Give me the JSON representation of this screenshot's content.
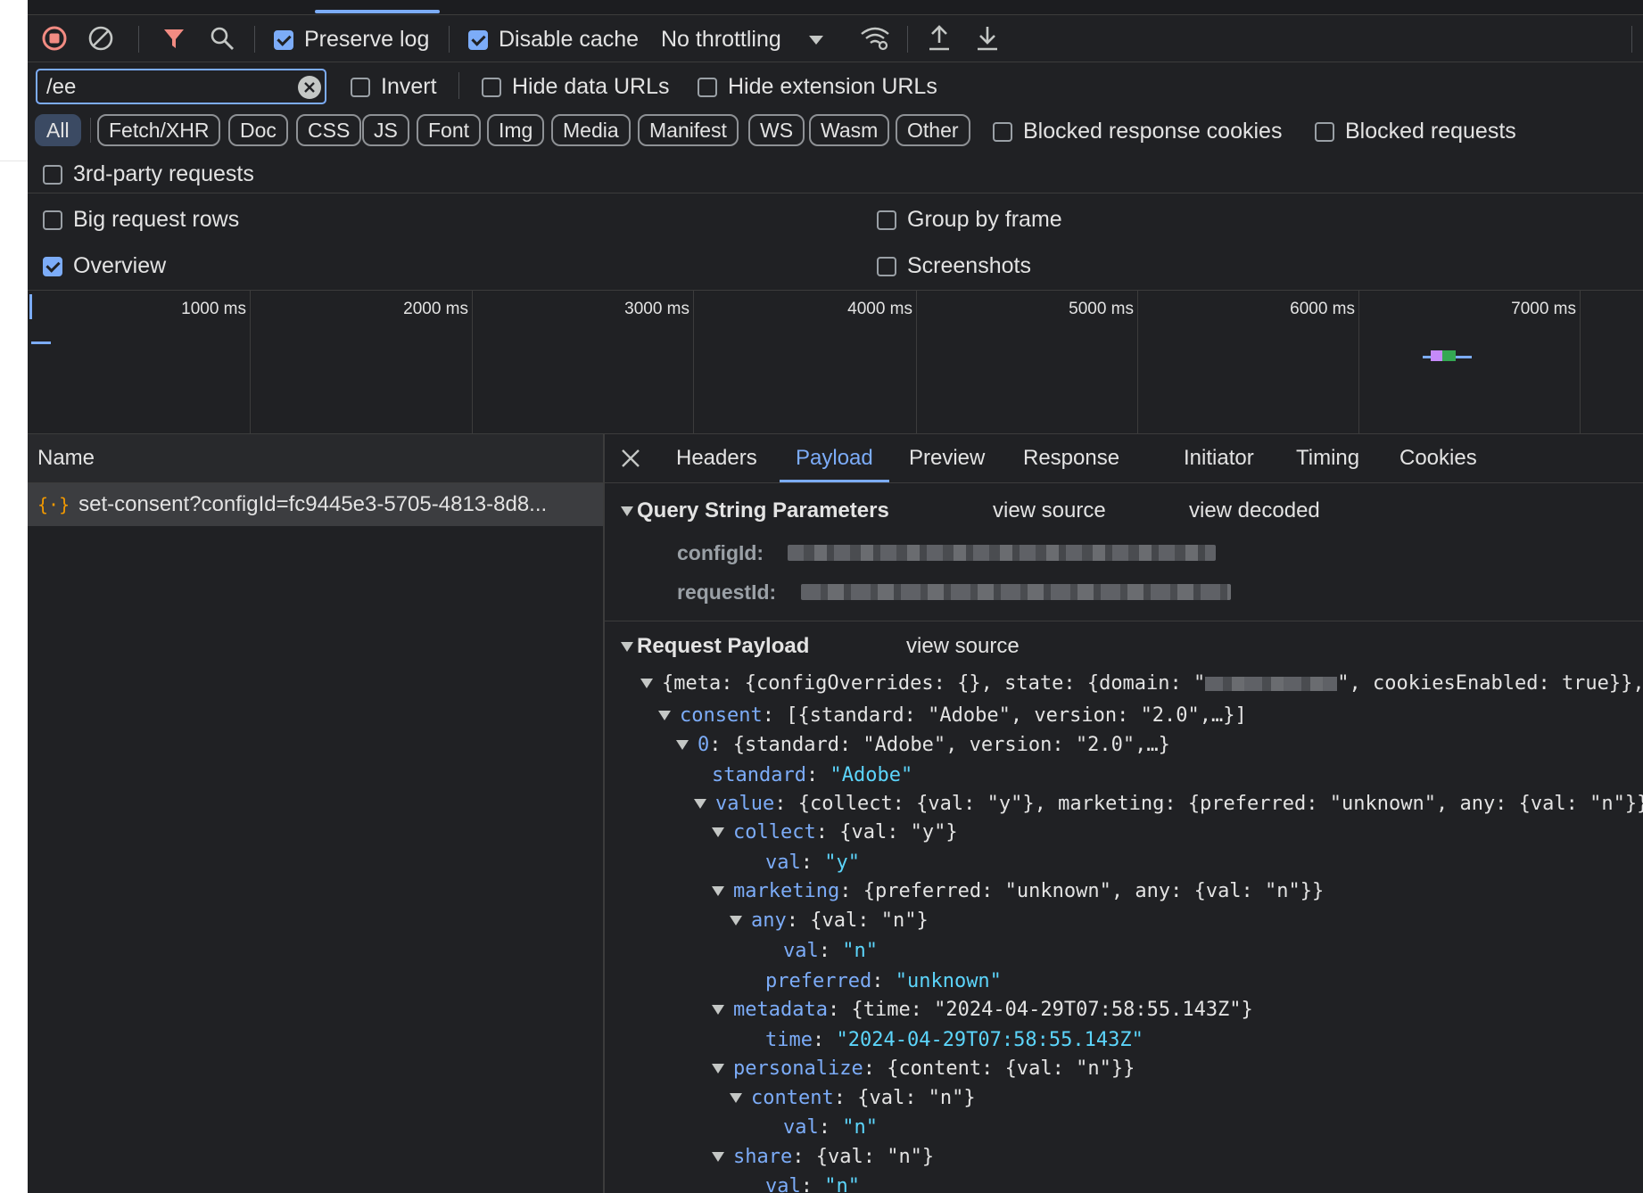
{
  "toolbar": {
    "preserve_log_label": "Preserve log",
    "preserve_log_checked": true,
    "disable_cache_label": "Disable cache",
    "disable_cache_checked": true,
    "throttling_value": "No throttling"
  },
  "filter": {
    "value": "/ee",
    "invert_label": "Invert",
    "hide_data_urls_label": "Hide data URLs",
    "hide_extension_urls_label": "Hide extension URLs"
  },
  "type_filters": [
    "All",
    "Fetch/XHR",
    "Doc",
    "CSS",
    "JS",
    "Font",
    "Img",
    "Media",
    "Manifest",
    "WS",
    "Wasm",
    "Other"
  ],
  "type_filter_active": "All",
  "blocked_response_cookies_label": "Blocked response cookies",
  "blocked_requests_label": "Blocked requests",
  "third_party_label": "3rd-party requests",
  "settings": {
    "big_request_rows_label": "Big request rows",
    "group_by_frame_label": "Group by frame",
    "overview_label": "Overview",
    "overview_checked": true,
    "screenshots_label": "Screenshots"
  },
  "overview": {
    "ticks": [
      "1000 ms",
      "2000 ms",
      "3000 ms",
      "4000 ms",
      "5000 ms",
      "6000 ms",
      "7000 ms"
    ]
  },
  "requests": {
    "header_name": "Name",
    "rows": [
      {
        "name": "set-consent?configId=fc9445e3-5705-4813-8d8..."
      }
    ]
  },
  "details": {
    "tabs": [
      "Headers",
      "Payload",
      "Preview",
      "Response",
      "Initiator",
      "Timing",
      "Cookies"
    ],
    "active_tab": "Payload",
    "query_section": {
      "title": "Query String Parameters",
      "view_source": "view source",
      "view_decoded": "view decoded",
      "params": [
        {
          "key": "configId:"
        },
        {
          "key": "requestId:"
        }
      ]
    },
    "payload_section": {
      "title": "Request Payload",
      "view_source": "view source"
    },
    "tree": {
      "root_prefix": "{meta: {configOverrides: {}, state: {domain: \"",
      "root_suffix": "\", cookiesEnabled: true}},",
      "consent_key": "consent",
      "consent_summary": ": [{standard: \"Adobe\", version: \"2.0\",…}]",
      "item0_key": "0",
      "item0_summary": ": {standard: \"Adobe\", version: \"2.0\",…}",
      "standard_key": "standard",
      "standard_val": "\"Adobe\"",
      "value_key": "value",
      "value_summary": ": {collect: {val: \"y\"}, marketing: {preferred: \"unknown\", any: {val: \"n\"}}",
      "collect_key": "collect",
      "collect_summary": ": {val: \"y\"}",
      "collect_val_key": "val",
      "collect_val": "\"y\"",
      "marketing_key": "marketing",
      "marketing_summary": ": {preferred: \"unknown\", any: {val: \"n\"}}",
      "any_key": "any",
      "any_summary": ": {val: \"n\"}",
      "any_val_key": "val",
      "any_val": "\"n\"",
      "preferred_key": "preferred",
      "preferred_val": "\"unknown\"",
      "metadata_key": "metadata",
      "metadata_summary": ": {time: \"2024-04-29T07:58:55.143Z\"}",
      "time_key": "time",
      "time_val": "\"2024-04-29T07:58:55.143Z\"",
      "personalize_key": "personalize",
      "personalize_summary": ": {content: {val: \"n\"}}",
      "content_key": "content",
      "content_summary": ": {val: \"n\"}",
      "content_val_key": "val",
      "content_val": "\"n\"",
      "share_key": "share",
      "share_summary": ": {val: \"n\"}",
      "share_val_key": "val",
      "share_val": "\"n\""
    }
  },
  "colors": {
    "background": "#202124",
    "accent": "#7cacf8",
    "string": "#5cd5fb",
    "record_red": "#f28b82"
  }
}
